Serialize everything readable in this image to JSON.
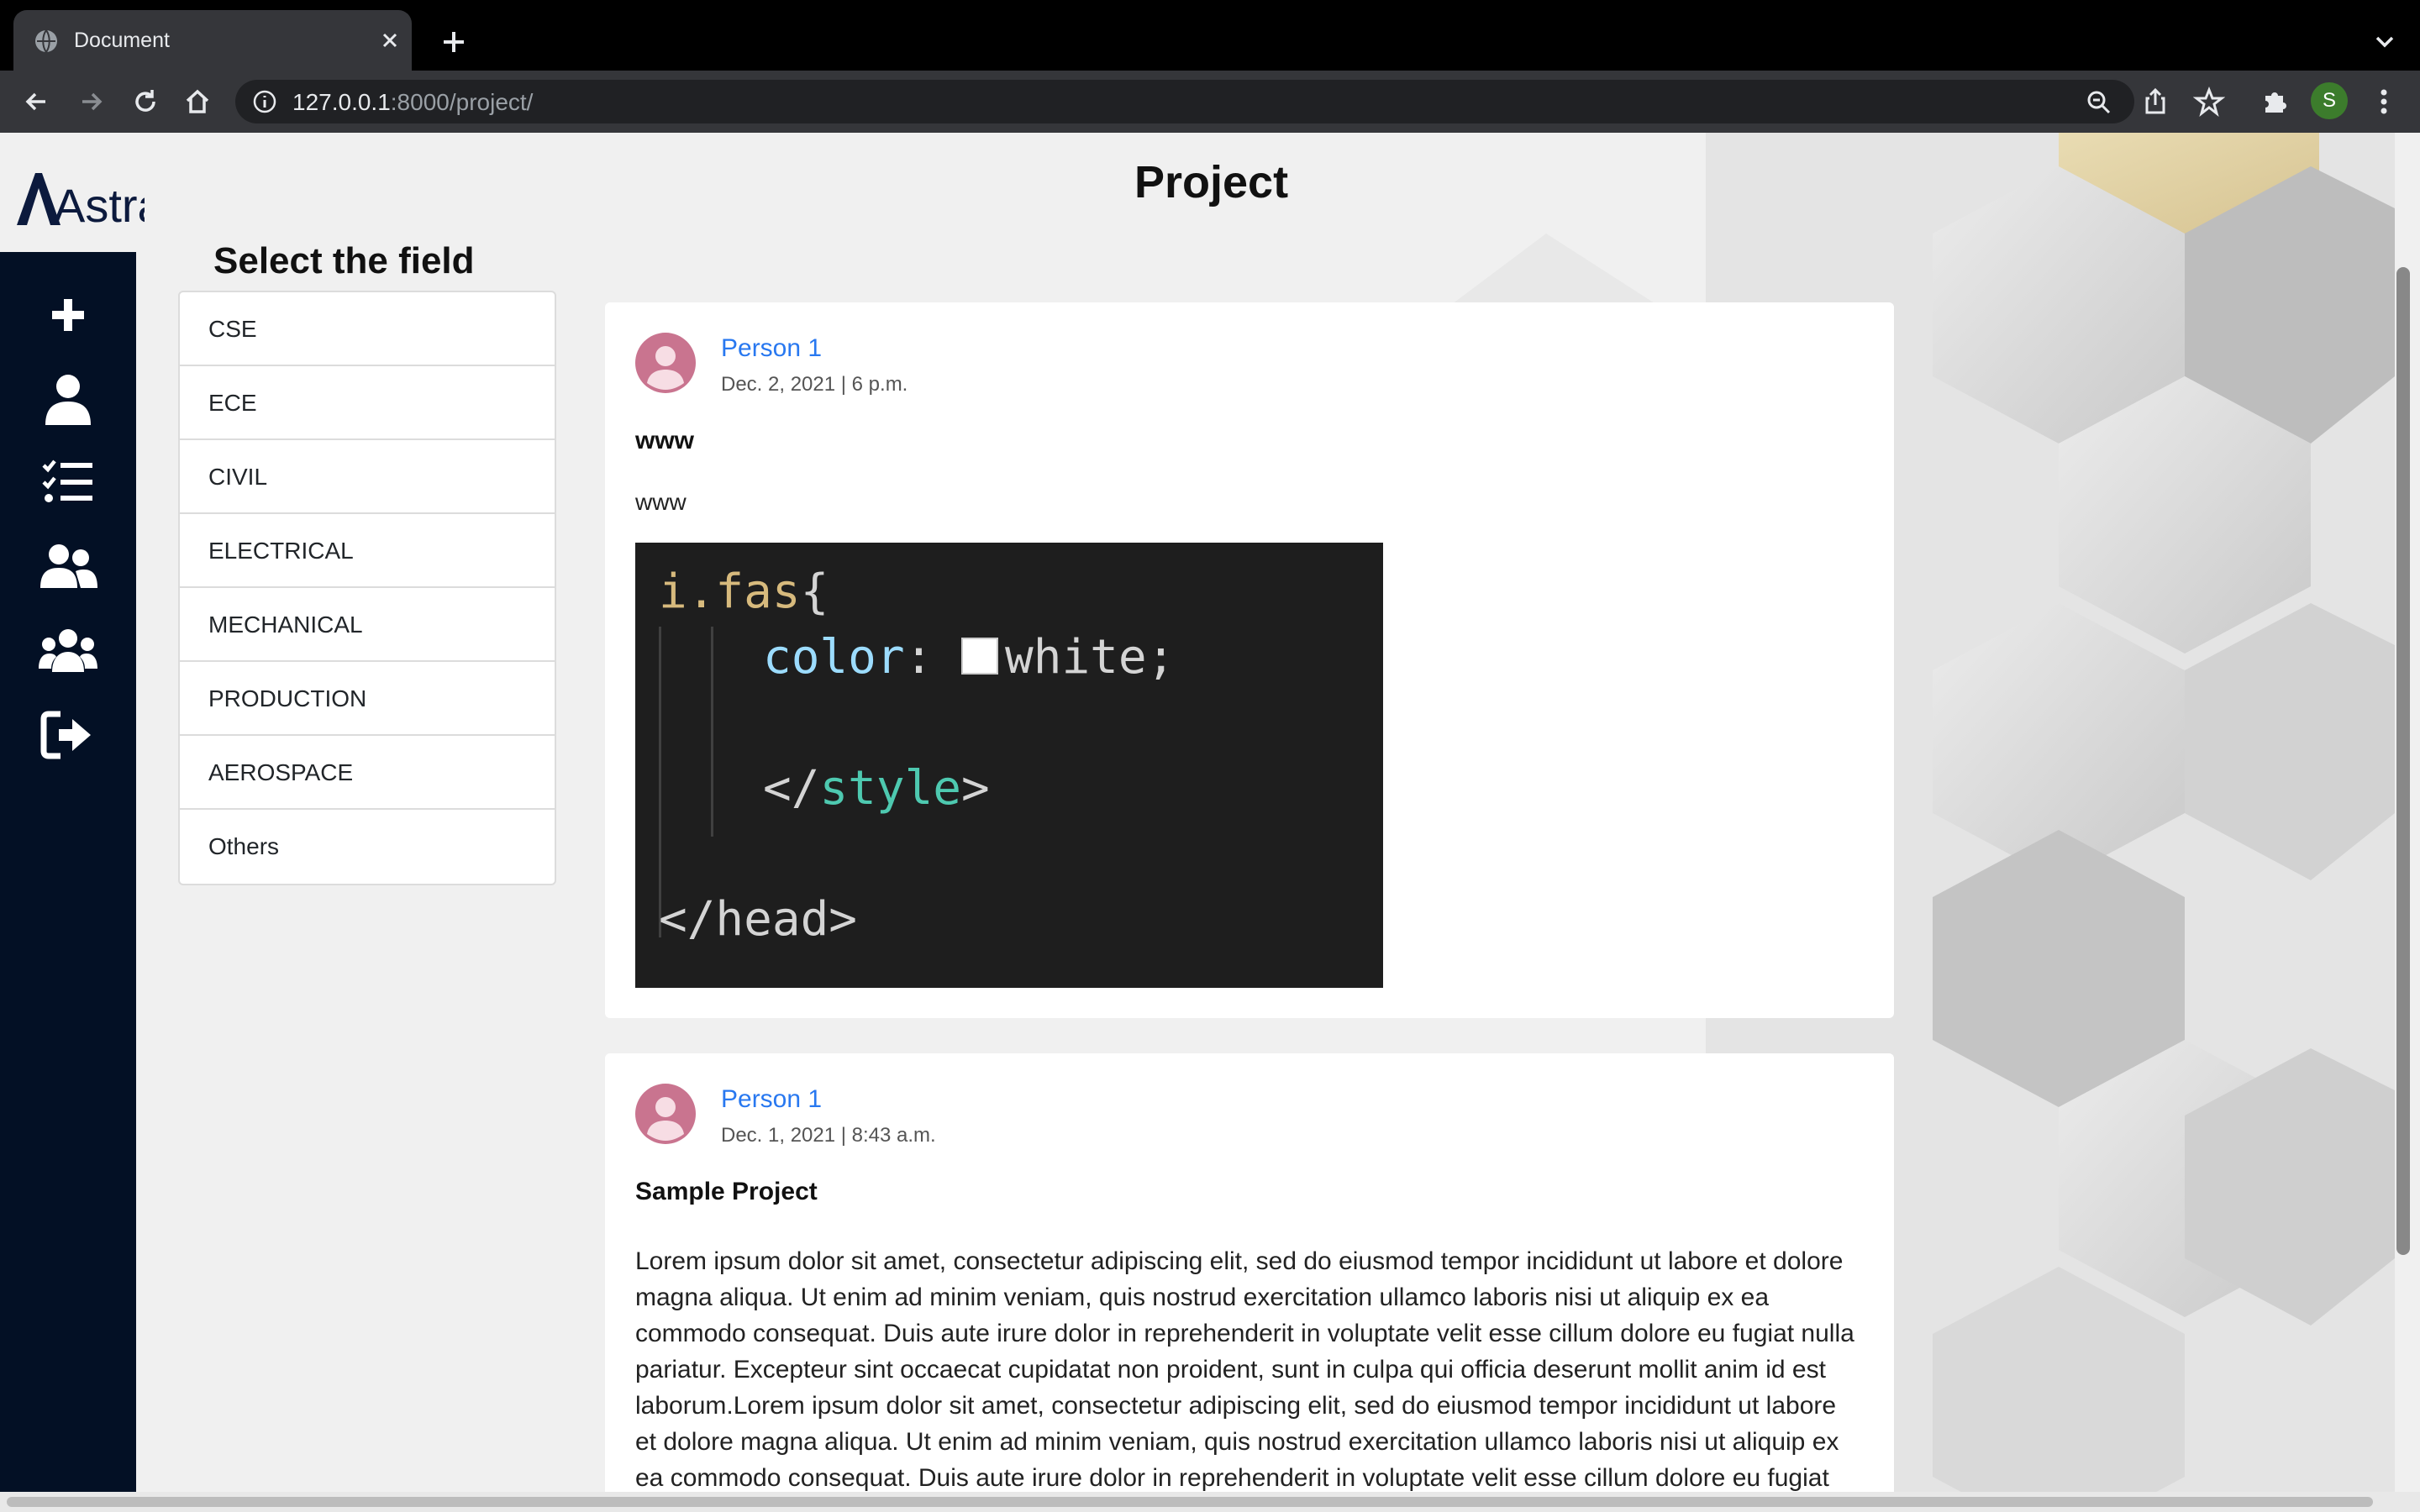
{
  "browser": {
    "tab_title": "Document",
    "url_host": "127.0.0.1",
    "url_rest": ":8000/project/",
    "profile_initial": "S"
  },
  "app": {
    "logo_text": "Astra",
    "page_title": "Project",
    "field_heading": "Select the field"
  },
  "fields": [
    "CSE",
    "ECE",
    "CIVIL",
    "ELECTRICAL",
    "MECHANICAL",
    "PRODUCTION",
    "AEROSPACE",
    "Others"
  ],
  "sidebar_icons": [
    "plus-icon",
    "user-icon",
    "tasks-icon",
    "user-friends-icon",
    "users-icon",
    "sign-out-icon"
  ],
  "posts": [
    {
      "author": "Person 1",
      "date": "Dec. 2, 2021 | 6 p.m.",
      "title": "www",
      "body": "www",
      "image_code": {
        "line1_sel": "i.fas",
        "line1_brace": "{",
        "line2_prop": "color",
        "line2_colon": ":",
        "line2_value": "white;",
        "line3_open": "</",
        "line3_tag": "style",
        "line3_close": ">",
        "line4": "</head>"
      }
    },
    {
      "author": "Person 1",
      "date": "Dec. 1, 2021 | 8:43 a.m.",
      "title": "Sample Project",
      "body": "Lorem ipsum dolor sit amet, consectetur adipiscing elit, sed do eiusmod tempor incididunt ut labore et dolore magna aliqua. Ut enim ad minim veniam, quis nostrud exercitation ullamco laboris nisi ut aliquip ex ea commodo consequat. Duis aute irure dolor in reprehenderit in voluptate velit esse cillum dolore eu fugiat nulla pariatur. Excepteur sint occaecat cupidatat non proident, sunt in culpa qui officia deserunt mollit anim id est laborum.Lorem ipsum dolor sit amet, consectetur adipiscing elit, sed do eiusmod tempor incididunt ut labore et dolore magna aliqua. Ut enim ad minim veniam, quis nostrud exercitation ullamco laboris nisi ut aliquip ex ea commodo consequat. Duis aute irure dolor in reprehenderit in voluptate velit esse cillum dolore eu fugiat nulla"
    }
  ],
  "colors": {
    "sidebar": "#031025",
    "accent_link": "#2878f0",
    "avatar_pink": "#c9748f",
    "code_bg": "#1e1e1e"
  }
}
